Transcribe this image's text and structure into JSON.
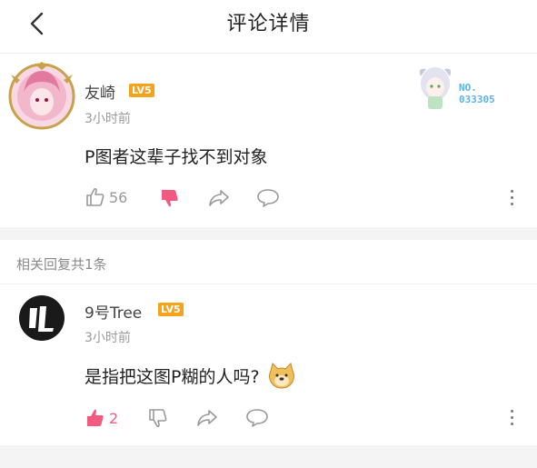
{
  "header": {
    "title": "评论详情"
  },
  "comment": {
    "author": "友崎",
    "level": "LV5",
    "time": "3小时前",
    "text": "P图者这辈子找不到对象",
    "likes": "56",
    "badge": {
      "line1": "NO.",
      "line2": "033305"
    }
  },
  "replies_header": "相关回复共1条",
  "reply": {
    "author": "9号Tree",
    "level": "LV5",
    "time": "3小时前",
    "text": "是指把这图P糊的人吗?",
    "likes": "2"
  },
  "colors": {
    "accent_pink": "#f25a7f",
    "level_badge": "#f7a21b",
    "badge_blue": "#5ab3e8"
  },
  "icons": [
    "back-arrow-icon",
    "thumbs-up-icon",
    "thumbs-down-icon",
    "share-icon",
    "comment-icon",
    "more-icon",
    "doge-emoji-icon"
  ]
}
